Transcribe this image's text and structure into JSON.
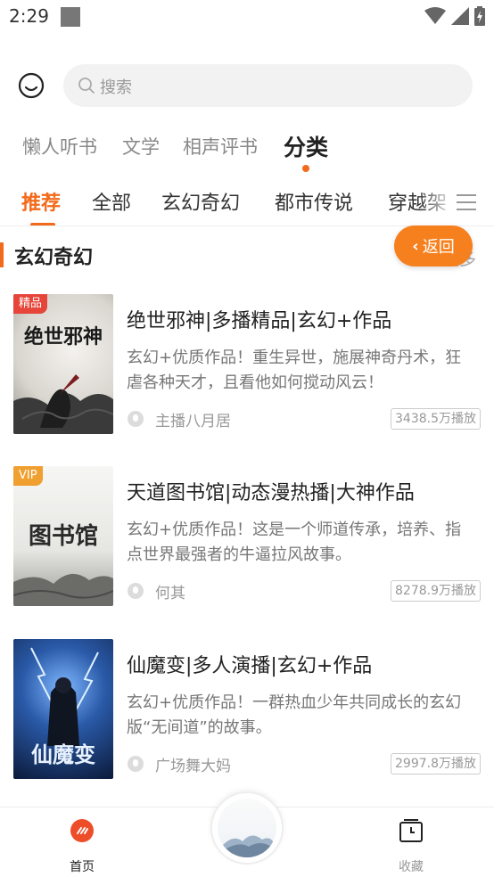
{
  "status": {
    "time": "2:29"
  },
  "search": {
    "placeholder": "搜索"
  },
  "top_tabs": [
    {
      "label": "懒人听书"
    },
    {
      "label": "文学"
    },
    {
      "label": "相声评书"
    },
    {
      "label": "分类",
      "active": true
    }
  ],
  "sub_tabs": [
    {
      "label": "推荐",
      "active": true
    },
    {
      "label": "全部"
    },
    {
      "label": "玄幻奇幻"
    },
    {
      "label": "都市传说"
    },
    {
      "label": "穿越架"
    }
  ],
  "section": {
    "title": "玄幻奇幻",
    "more": "更多",
    "back_label": "返回"
  },
  "books": [
    {
      "badge": "精品",
      "badge_color": "#e6453a",
      "cover_text": "绝世邪神",
      "title": "绝世邪神|多播精品|玄幻+作品",
      "desc": "玄幻+优质作品！重生异世，施展神奇丹术，狂虐各种天才，且看他如何搅动风云！",
      "author": "主播八月居",
      "plays": "3438.5万播放"
    },
    {
      "badge": "VIP",
      "badge_color": "#f0a030",
      "cover_text": "图书馆",
      "title": "天道图书馆|动态漫热播|大神作品",
      "desc": "玄幻+优质作品！这是一个师道传承，培养、指点世界最强者的牛逼拉风故事。",
      "author": "何其",
      "plays": "8278.9万播放"
    },
    {
      "badge": "",
      "badge_color": "",
      "cover_text": "仙魔变",
      "title": "仙魔变|多人演播|玄幻+作品",
      "desc": "玄幻+优质作品！一群热血少年共同成长的玄幻版“无间道”的故事。",
      "author": "广场舞大妈",
      "plays": "2997.8万播放"
    }
  ],
  "bottom_nav": {
    "home_label": "首页",
    "fav_label": "收藏"
  },
  "colors": {
    "accent": "#f26a1b",
    "back_button": "#f7801e"
  }
}
